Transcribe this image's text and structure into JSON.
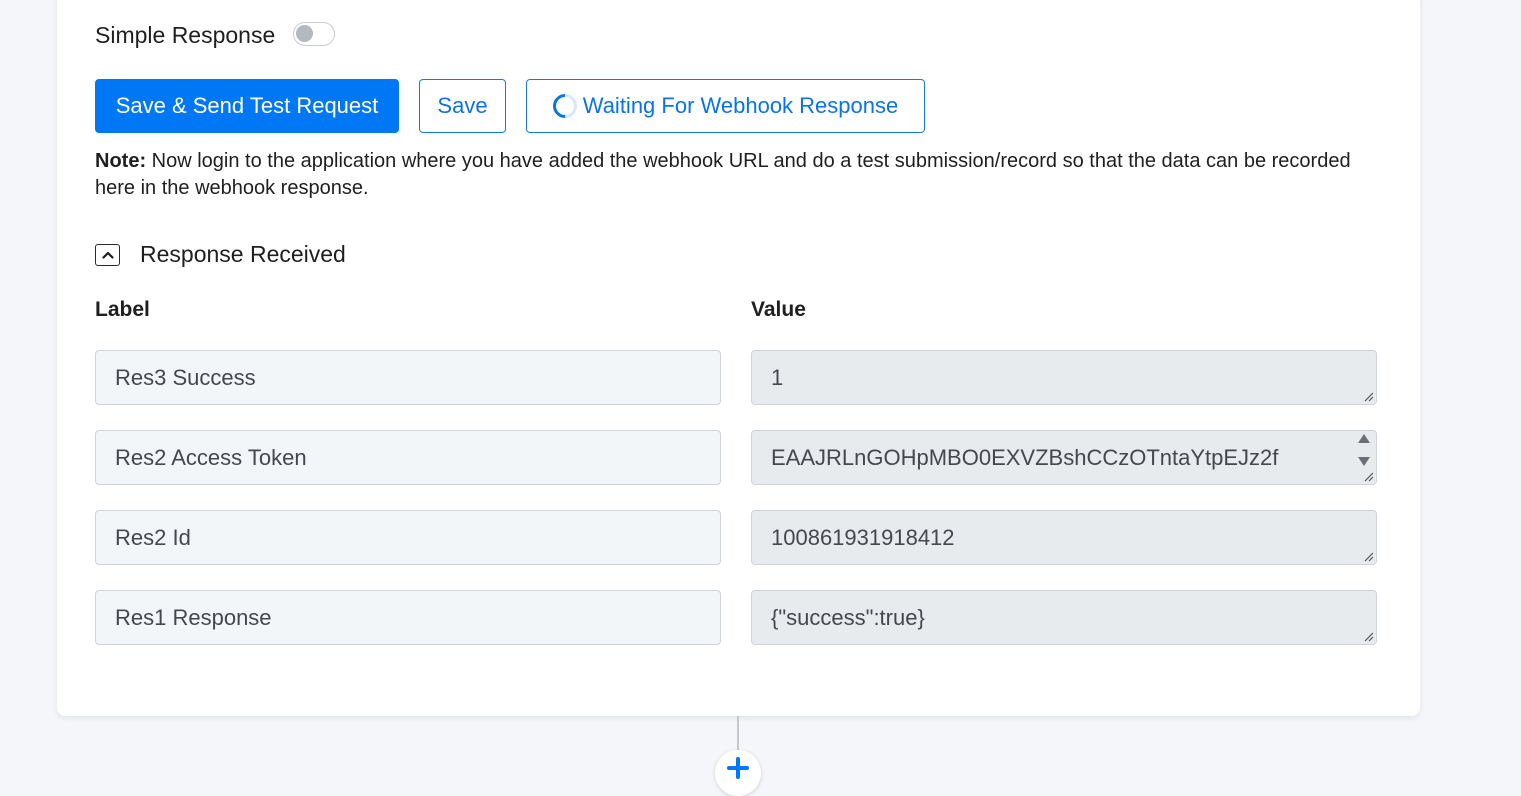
{
  "simple_response": {
    "label": "Simple Response",
    "enabled": false
  },
  "buttons": {
    "save_send_test": "Save & Send Test Request",
    "save": "Save",
    "waiting": "Waiting For Webhook Response"
  },
  "note": {
    "prefix": "Note:",
    "text": " Now login to the application where you have added the webhook URL and do a test submission/record so that the data can be recorded here in the webhook response."
  },
  "response_section": {
    "title": "Response Received",
    "expanded": true,
    "columns": {
      "label": "Label",
      "value": "Value"
    },
    "rows": [
      {
        "label": "Res3 Success",
        "value": "1"
      },
      {
        "label": "Res2 Access Token",
        "value": "EAAJRLnGOHpMBO0EXVZBshCCzOTntaYtpEJz2f"
      },
      {
        "label": "Res2 Id",
        "value": "100861931918412"
      },
      {
        "label": "Res1 Response",
        "value": "{\"success\":true}"
      }
    ]
  },
  "colors": {
    "primary": "#0077f5",
    "outline_blue": "#0a74e6",
    "label_field_bg": "#f3f6f9",
    "value_field_bg": "#e8ebee"
  },
  "icons": {
    "toggle": "toggle-off-icon",
    "spinner": "loading-spinner-icon",
    "accordion": "chevron-up-icon",
    "add": "plus-icon"
  }
}
